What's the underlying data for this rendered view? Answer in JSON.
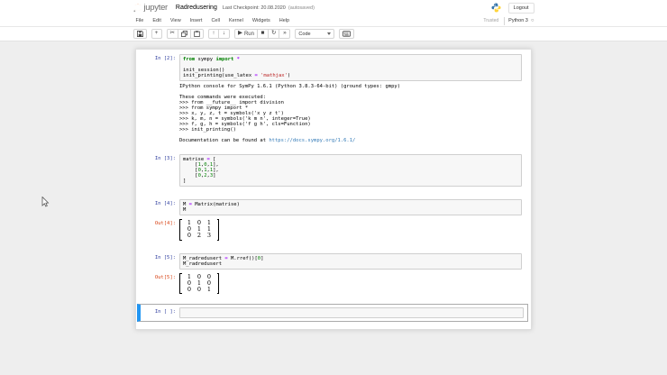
{
  "header": {
    "logo_text": "jupyter",
    "title": "Radredusering",
    "checkpoint": "Last Checkpoint: 20.08.2020",
    "autosaved": "(autosaved)",
    "logout_label": "Logout"
  },
  "menu": {
    "items": [
      "File",
      "Edit",
      "View",
      "Insert",
      "Cell",
      "Kernel",
      "Widgets",
      "Help"
    ],
    "trusted": "Trusted",
    "kernel_name": "Python 3"
  },
  "toolbar": {
    "run_label": "Run",
    "cell_type_value": "Code",
    "icons": {
      "plus": "+",
      "scissors": "✂",
      "up": "↑",
      "down": "↓",
      "step_forward": "▶",
      "stop": "■",
      "refresh": "↻",
      "fast_forward": "»",
      "kernel_idle": "○"
    }
  },
  "colors": {
    "prompt_in": "#303f9f",
    "prompt_out": "#d84315",
    "selected_cell_bar": "#2196f3",
    "link": "#337ab7",
    "jupyter_orange": "#f37726",
    "keyword": "#008000",
    "string": "#ba2121",
    "operator": "#aa22ff",
    "body_bg": "#eeeeee"
  },
  "cells": [
    {
      "prompt": "In [2]:",
      "code": [
        [
          [
            "kw",
            "from"
          ],
          [
            "pl",
            " sympy "
          ],
          [
            "kw",
            "import"
          ],
          [
            "op",
            " *"
          ]
        ],
        [],
        [
          [
            "pl",
            "init_session()"
          ]
        ],
        [
          [
            "pl",
            "init_printing(use_latex "
          ],
          [
            "op",
            "="
          ],
          [
            "pl",
            " "
          ],
          [
            "str",
            "'mathjax'"
          ],
          [
            "pl",
            ")"
          ]
        ]
      ],
      "outputs": {
        "console1": "IPython console for SymPy 1.6.1 (Python 3.8.3-64-bit) (ground types: gmpy)",
        "console2": "These commands were executed:\n>>> from __future__ import division\n>>> from sympy import *\n>>> x, y, z, t = symbols('x y z t')\n>>> k, m, n = symbols('k m n', integer=True)\n>>> f, g, h = symbols('f g h', cls=Function)\n>>> init_printing()\n\nDocumentation can be found at ",
        "doc_link": "https://docs.sympy.org/1.6.1/"
      }
    },
    {
      "prompt": "In [3]:",
      "code": [
        [
          [
            "pl",
            "matrise "
          ],
          [
            "op",
            "="
          ],
          [
            "pl",
            " ["
          ]
        ],
        [
          [
            "pl",
            "    ["
          ],
          [
            "num",
            "1"
          ],
          [
            "pl",
            ","
          ],
          [
            "num",
            "0"
          ],
          [
            "pl",
            ","
          ],
          [
            "num",
            "1"
          ],
          [
            "pl",
            "],"
          ]
        ],
        [
          [
            "pl",
            "    ["
          ],
          [
            "num",
            "0"
          ],
          [
            "pl",
            ","
          ],
          [
            "num",
            "1"
          ],
          [
            "pl",
            ","
          ],
          [
            "num",
            "1"
          ],
          [
            "pl",
            "],"
          ]
        ],
        [
          [
            "pl",
            "    ["
          ],
          [
            "num",
            "0"
          ],
          [
            "pl",
            ","
          ],
          [
            "num",
            "2"
          ],
          [
            "pl",
            ","
          ],
          [
            "num",
            "3"
          ],
          [
            "pl",
            "]"
          ]
        ],
        [
          [
            "pl",
            "]"
          ]
        ]
      ]
    },
    {
      "prompt": "In [4]:",
      "code": [
        [
          [
            "pl",
            "M "
          ],
          [
            "op",
            "="
          ],
          [
            "pl",
            " Matrix(matrise)"
          ]
        ],
        [
          [
            "pl",
            "M"
          ]
        ]
      ],
      "out_prompt": "Out[4]:",
      "matrix": [
        [
          1,
          0,
          1
        ],
        [
          0,
          1,
          1
        ],
        [
          0,
          2,
          3
        ]
      ]
    },
    {
      "prompt": "In [5]:",
      "code": [
        [
          [
            "pl",
            "M_radredusert "
          ],
          [
            "op",
            "="
          ],
          [
            "pl",
            " M.rref()["
          ],
          [
            "num",
            "0"
          ],
          [
            "pl",
            "]"
          ]
        ],
        [
          [
            "pl",
            "M_radredusert"
          ]
        ]
      ],
      "out_prompt": "Out[5]:",
      "matrix": [
        [
          1,
          0,
          0
        ],
        [
          0,
          1,
          0
        ],
        [
          0,
          0,
          1
        ]
      ]
    },
    {
      "prompt": "In [ ]:",
      "code": []
    }
  ]
}
